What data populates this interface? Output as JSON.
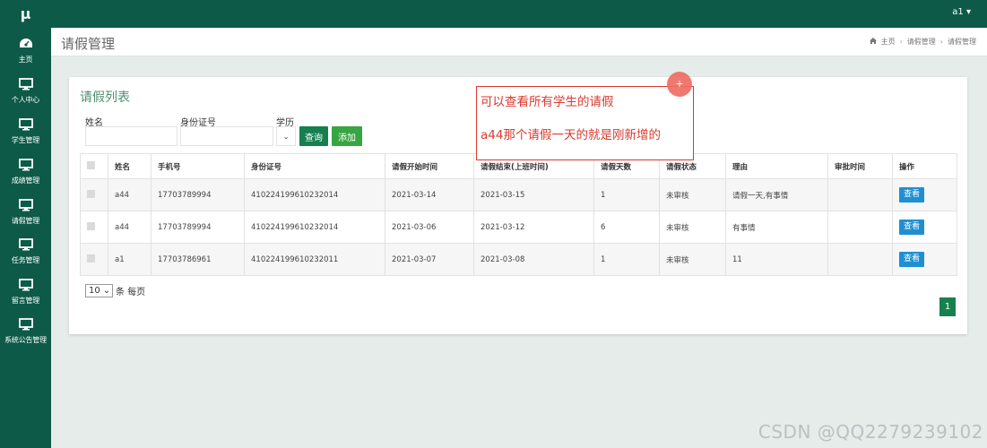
{
  "app": {
    "logo": "μ",
    "user": "a1"
  },
  "sidebar": {
    "items": [
      {
        "label": "主页",
        "icon": "dashboard-icon"
      },
      {
        "label": "个人中心",
        "icon": "monitor-icon"
      },
      {
        "label": "学生管理",
        "icon": "monitor-icon"
      },
      {
        "label": "成绩管理",
        "icon": "monitor-icon"
      },
      {
        "label": "请假管理",
        "icon": "monitor-icon"
      },
      {
        "label": "任务管理",
        "icon": "monitor-icon"
      },
      {
        "label": "留言管理",
        "icon": "monitor-icon"
      },
      {
        "label": "系统公告管理",
        "icon": "monitor-icon"
      }
    ]
  },
  "header": {
    "title": "请假管理",
    "breadcrumb": [
      "主页",
      "请假管理",
      "请假管理"
    ]
  },
  "panel": {
    "title": "请假列表",
    "filters": {
      "name_label": "姓名",
      "name_value": "",
      "id_label": "身份证号",
      "id_value": "",
      "edu_label": "学历",
      "edu_value": ""
    },
    "search_button": "查询",
    "add_button": "添加"
  },
  "table": {
    "columns": [
      "姓名",
      "手机号",
      "身份证号",
      "请假开始时间",
      "请假结束(上班时间)",
      "请假天数",
      "请假状态",
      "理由",
      "审批时间",
      "操作"
    ],
    "rows": [
      {
        "name": "a44",
        "phone": "17703789994",
        "id": "410224199610232014",
        "start": "2021-03-14",
        "end": "2021-03-15",
        "days": "1",
        "status": "未审核",
        "reason": "请假一天,有事情",
        "approve_time": "",
        "action": "查看"
      },
      {
        "name": "a44",
        "phone": "17703789994",
        "id": "410224199610232014",
        "start": "2021-03-06",
        "end": "2021-03-12",
        "days": "6",
        "status": "未审核",
        "reason": "有事情",
        "approve_time": "",
        "action": "查看"
      },
      {
        "name": "a1",
        "phone": "17703786961",
        "id": "410224199610232011",
        "start": "2021-03-07",
        "end": "2021-03-08",
        "days": "1",
        "status": "未审核",
        "reason": "11",
        "approve_time": "",
        "action": "查看"
      }
    ]
  },
  "pagination": {
    "page_size": "10",
    "per_page_label": "条 每页",
    "current_page": "1"
  },
  "annotation": {
    "line1": "可以查看所有学生的请假",
    "line2": "a44那个请假一天的就是刚新增的"
  },
  "watermark": "CSDN @QQ2279239102",
  "colors": {
    "brand": "#0e5a48",
    "accent_green": "#157f50",
    "add_green": "#37a541",
    "view_blue": "#1f8fd2",
    "annotation_red": "#d9392e"
  }
}
